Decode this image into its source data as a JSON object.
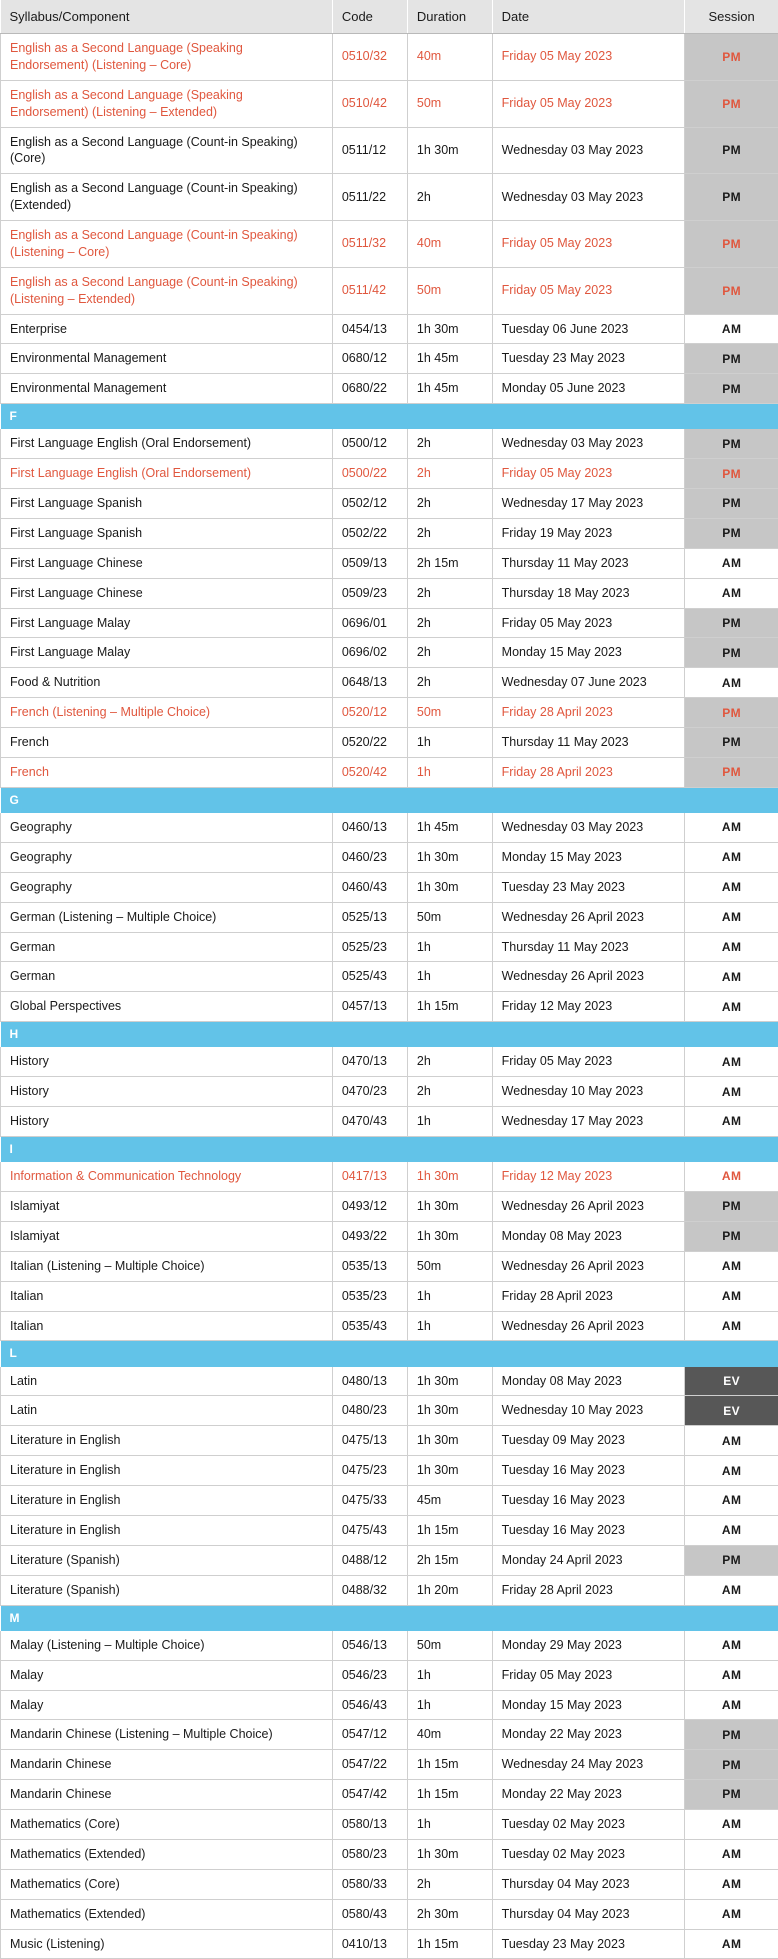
{
  "table": {
    "columns": [
      {
        "key": "syllabus",
        "label": "Syllabus/Component"
      },
      {
        "key": "code",
        "label": "Code"
      },
      {
        "key": "duration",
        "label": "Duration"
      },
      {
        "key": "date",
        "label": "Date"
      },
      {
        "key": "session",
        "label": "Session"
      }
    ],
    "colors": {
      "header_bg": "#e4e4e4",
      "section_band_bg": "#62c3e8",
      "highlight_text": "#e0573e",
      "session_pm_bg": "#c6c6c6",
      "session_ev_bg": "#575757",
      "session_am_bg": "#ffffff",
      "grid_line": "#cfcfcf"
    },
    "rows": [
      {
        "type": "row",
        "highlight": true,
        "syllabus": "English as a Second Language (Speaking Endorsement) (Listening – Core)",
        "code": "0510/32",
        "duration": "40m",
        "date": "Friday 05 May 2023",
        "session": "PM"
      },
      {
        "type": "row",
        "highlight": true,
        "syllabus": "English as a Second Language (Speaking Endorsement) (Listening – Extended)",
        "code": "0510/42",
        "duration": "50m",
        "date": "Friday 05 May 2023",
        "session": "PM"
      },
      {
        "type": "row",
        "highlight": false,
        "syllabus": "English as a Second Language (Count-in Speaking) (Core)",
        "code": "0511/12",
        "duration": "1h 30m",
        "date": "Wednesday 03 May 2023",
        "session": "PM"
      },
      {
        "type": "row",
        "highlight": false,
        "syllabus": "English as a Second Language (Count-in Speaking) (Extended)",
        "code": "0511/22",
        "duration": "2h",
        "date": "Wednesday 03 May 2023",
        "session": "PM"
      },
      {
        "type": "row",
        "highlight": true,
        "syllabus": "English as a Second Language (Count-in Speaking) (Listening – Core)",
        "code": "0511/32",
        "duration": "40m",
        "date": "Friday 05 May 2023",
        "session": "PM"
      },
      {
        "type": "row",
        "highlight": true,
        "syllabus": "English as a Second Language (Count-in Speaking) (Listening – Extended)",
        "code": "0511/42",
        "duration": "50m",
        "date": "Friday 05 May 2023",
        "session": "PM"
      },
      {
        "type": "row",
        "highlight": false,
        "syllabus": "Enterprise",
        "code": "0454/13",
        "duration": "1h 30m",
        "date": "Tuesday 06 June 2023",
        "session": "AM"
      },
      {
        "type": "row",
        "highlight": false,
        "syllabus": "Environmental Management",
        "code": "0680/12",
        "duration": "1h 45m",
        "date": "Tuesday 23 May 2023",
        "session": "PM"
      },
      {
        "type": "row",
        "highlight": false,
        "syllabus": "Environmental Management",
        "code": "0680/22",
        "duration": "1h 45m",
        "date": "Monday 05 June 2023",
        "session": "PM"
      },
      {
        "type": "section",
        "letter": "F"
      },
      {
        "type": "row",
        "highlight": false,
        "syllabus": "First Language English (Oral Endorsement)",
        "code": "0500/12",
        "duration": "2h",
        "date": "Wednesday 03 May 2023",
        "session": "PM"
      },
      {
        "type": "row",
        "highlight": true,
        "syllabus": "First Language English (Oral Endorsement)",
        "code": "0500/22",
        "duration": "2h",
        "date": "Friday 05 May 2023",
        "session": "PM"
      },
      {
        "type": "row",
        "highlight": false,
        "syllabus": "First Language Spanish",
        "code": "0502/12",
        "duration": "2h",
        "date": "Wednesday 17 May 2023",
        "session": "PM"
      },
      {
        "type": "row",
        "highlight": false,
        "syllabus": "First Language Spanish",
        "code": "0502/22",
        "duration": "2h",
        "date": "Friday 19 May 2023",
        "session": "PM"
      },
      {
        "type": "row",
        "highlight": false,
        "syllabus": "First Language Chinese",
        "code": "0509/13",
        "duration": "2h 15m",
        "date": "Thursday 11 May 2023",
        "session": "AM"
      },
      {
        "type": "row",
        "highlight": false,
        "syllabus": "First Language Chinese",
        "code": "0509/23",
        "duration": "2h",
        "date": "Thursday 18 May 2023",
        "session": "AM"
      },
      {
        "type": "row",
        "highlight": false,
        "syllabus": "First Language Malay",
        "code": "0696/01",
        "duration": "2h",
        "date": "Friday 05 May 2023",
        "session": "PM"
      },
      {
        "type": "row",
        "highlight": false,
        "syllabus": "First Language Malay",
        "code": "0696/02",
        "duration": "2h",
        "date": "Monday 15 May 2023",
        "session": "PM"
      },
      {
        "type": "row",
        "highlight": false,
        "syllabus": "Food & Nutrition",
        "code": "0648/13",
        "duration": "2h",
        "date": "Wednesday 07 June 2023",
        "session": "AM"
      },
      {
        "type": "row",
        "highlight": true,
        "syllabus": "French (Listening – Multiple Choice)",
        "code": "0520/12",
        "duration": "50m",
        "date": "Friday 28 April 2023",
        "session": "PM"
      },
      {
        "type": "row",
        "highlight": false,
        "syllabus": "French",
        "code": "0520/22",
        "duration": "1h",
        "date": "Thursday 11 May 2023",
        "session": "PM"
      },
      {
        "type": "row",
        "highlight": true,
        "syllabus": "French",
        "code": "0520/42",
        "duration": "1h",
        "date": "Friday 28 April 2023",
        "session": "PM"
      },
      {
        "type": "section",
        "letter": "G"
      },
      {
        "type": "row",
        "highlight": false,
        "syllabus": "Geography",
        "code": "0460/13",
        "duration": "1h 45m",
        "date": "Wednesday 03 May 2023",
        "session": "AM"
      },
      {
        "type": "row",
        "highlight": false,
        "syllabus": "Geography",
        "code": "0460/23",
        "duration": "1h 30m",
        "date": "Monday 15 May 2023",
        "session": "AM"
      },
      {
        "type": "row",
        "highlight": false,
        "syllabus": "Geography",
        "code": "0460/43",
        "duration": "1h 30m",
        "date": "Tuesday 23 May 2023",
        "session": "AM"
      },
      {
        "type": "row",
        "highlight": false,
        "syllabus": "German (Listening – Multiple Choice)",
        "code": "0525/13",
        "duration": "50m",
        "date": "Wednesday 26 April 2023",
        "session": "AM"
      },
      {
        "type": "row",
        "highlight": false,
        "syllabus": "German",
        "code": "0525/23",
        "duration": "1h",
        "date": "Thursday 11 May 2023",
        "session": "AM"
      },
      {
        "type": "row",
        "highlight": false,
        "syllabus": "German",
        "code": "0525/43",
        "duration": "1h",
        "date": "Wednesday 26 April 2023",
        "session": "AM"
      },
      {
        "type": "row",
        "highlight": false,
        "syllabus": "Global Perspectives",
        "code": "0457/13",
        "duration": "1h 15m",
        "date": "Friday 12 May 2023",
        "session": "AM"
      },
      {
        "type": "section",
        "letter": "H"
      },
      {
        "type": "row",
        "highlight": false,
        "syllabus": "History",
        "code": "0470/13",
        "duration": "2h",
        "date": "Friday 05 May 2023",
        "session": "AM"
      },
      {
        "type": "row",
        "highlight": false,
        "syllabus": "History",
        "code": "0470/23",
        "duration": "2h",
        "date": "Wednesday 10 May 2023",
        "session": "AM"
      },
      {
        "type": "row",
        "highlight": false,
        "syllabus": "History",
        "code": "0470/43",
        "duration": "1h",
        "date": "Wednesday 17 May 2023",
        "session": "AM"
      },
      {
        "type": "section",
        "letter": "I"
      },
      {
        "type": "row",
        "highlight": true,
        "syllabus": "Information & Communication Technology",
        "code": "0417/13",
        "duration": "1h 30m",
        "date": "Friday 12 May 2023",
        "session": "AM"
      },
      {
        "type": "row",
        "highlight": false,
        "syllabus": "Islamiyat",
        "code": "0493/12",
        "duration": "1h 30m",
        "date": "Wednesday 26 April 2023",
        "session": "PM"
      },
      {
        "type": "row",
        "highlight": false,
        "syllabus": "Islamiyat",
        "code": "0493/22",
        "duration": "1h 30m",
        "date": "Monday 08 May 2023",
        "session": "PM"
      },
      {
        "type": "row",
        "highlight": false,
        "syllabus": "Italian (Listening – Multiple Choice)",
        "code": "0535/13",
        "duration": "50m",
        "date": "Wednesday 26 April 2023",
        "session": "AM"
      },
      {
        "type": "row",
        "highlight": false,
        "syllabus": "Italian",
        "code": "0535/23",
        "duration": "1h",
        "date": "Friday 28 April 2023",
        "session": "AM"
      },
      {
        "type": "row",
        "highlight": false,
        "syllabus": "Italian",
        "code": "0535/43",
        "duration": "1h",
        "date": "Wednesday 26 April 2023",
        "session": "AM"
      },
      {
        "type": "section",
        "letter": "L"
      },
      {
        "type": "row",
        "highlight": false,
        "syllabus": "Latin",
        "code": "0480/13",
        "duration": "1h 30m",
        "date": "Monday 08 May 2023",
        "session": "EV"
      },
      {
        "type": "row",
        "highlight": false,
        "syllabus": "Latin",
        "code": "0480/23",
        "duration": "1h 30m",
        "date": "Wednesday 10 May 2023",
        "session": "EV"
      },
      {
        "type": "row",
        "highlight": false,
        "syllabus": "Literature in English",
        "code": "0475/13",
        "duration": "1h 30m",
        "date": "Tuesday 09 May 2023",
        "session": "AM"
      },
      {
        "type": "row",
        "highlight": false,
        "syllabus": "Literature in English",
        "code": "0475/23",
        "duration": "1h 30m",
        "date": "Tuesday 16 May 2023",
        "session": "AM"
      },
      {
        "type": "row",
        "highlight": false,
        "syllabus": "Literature in English",
        "code": "0475/33",
        "duration": "45m",
        "date": "Tuesday 16 May 2023",
        "session": "AM"
      },
      {
        "type": "row",
        "highlight": false,
        "syllabus": "Literature in English",
        "code": "0475/43",
        "duration": "1h 15m",
        "date": "Tuesday 16 May 2023",
        "session": "AM"
      },
      {
        "type": "row",
        "highlight": false,
        "syllabus": "Literature (Spanish)",
        "code": "0488/12",
        "duration": "2h 15m",
        "date": "Monday 24 April 2023",
        "session": "PM"
      },
      {
        "type": "row",
        "highlight": false,
        "syllabus": "Literature (Spanish)",
        "code": "0488/32",
        "duration": "1h 20m",
        "date": "Friday 28 April 2023",
        "session": "AM"
      },
      {
        "type": "section",
        "letter": "M"
      },
      {
        "type": "row",
        "highlight": false,
        "syllabus": "Malay (Listening – Multiple Choice)",
        "code": "0546/13",
        "duration": "50m",
        "date": "Monday 29 May 2023",
        "session": "AM"
      },
      {
        "type": "row",
        "highlight": false,
        "syllabus": "Malay",
        "code": "0546/23",
        "duration": "1h",
        "date": "Friday 05 May 2023",
        "session": "AM"
      },
      {
        "type": "row",
        "highlight": false,
        "syllabus": "Malay",
        "code": "0546/43",
        "duration": "1h",
        "date": "Monday 15 May 2023",
        "session": "AM"
      },
      {
        "type": "row",
        "highlight": false,
        "syllabus": "Mandarin Chinese (Listening – Multiple Choice)",
        "code": "0547/12",
        "duration": "40m",
        "date": "Monday 22 May 2023",
        "session": "PM"
      },
      {
        "type": "row",
        "highlight": false,
        "syllabus": "Mandarin Chinese",
        "code": "0547/22",
        "duration": "1h 15m",
        "date": "Wednesday 24 May 2023",
        "session": "PM"
      },
      {
        "type": "row",
        "highlight": false,
        "syllabus": "Mandarin Chinese",
        "code": "0547/42",
        "duration": "1h 15m",
        "date": "Monday 22 May 2023",
        "session": "PM"
      },
      {
        "type": "row",
        "highlight": false,
        "syllabus": "Mathematics (Core)",
        "code": "0580/13",
        "duration": "1h",
        "date": "Tuesday 02 May 2023",
        "session": "AM"
      },
      {
        "type": "row",
        "highlight": false,
        "syllabus": "Mathematics (Extended)",
        "code": "0580/23",
        "duration": "1h 30m",
        "date": "Tuesday 02 May 2023",
        "session": "AM"
      },
      {
        "type": "row",
        "highlight": false,
        "syllabus": "Mathematics (Core)",
        "code": "0580/33",
        "duration": "2h",
        "date": "Thursday 04 May 2023",
        "session": "AM"
      },
      {
        "type": "row",
        "highlight": false,
        "syllabus": "Mathematics (Extended)",
        "code": "0580/43",
        "duration": "2h 30m",
        "date": "Thursday 04 May 2023",
        "session": "AM"
      },
      {
        "type": "row",
        "highlight": false,
        "syllabus": "Music (Listening)",
        "code": "0410/13",
        "duration": "1h 15m",
        "date": "Tuesday 23 May 2023",
        "session": "AM"
      }
    ]
  }
}
